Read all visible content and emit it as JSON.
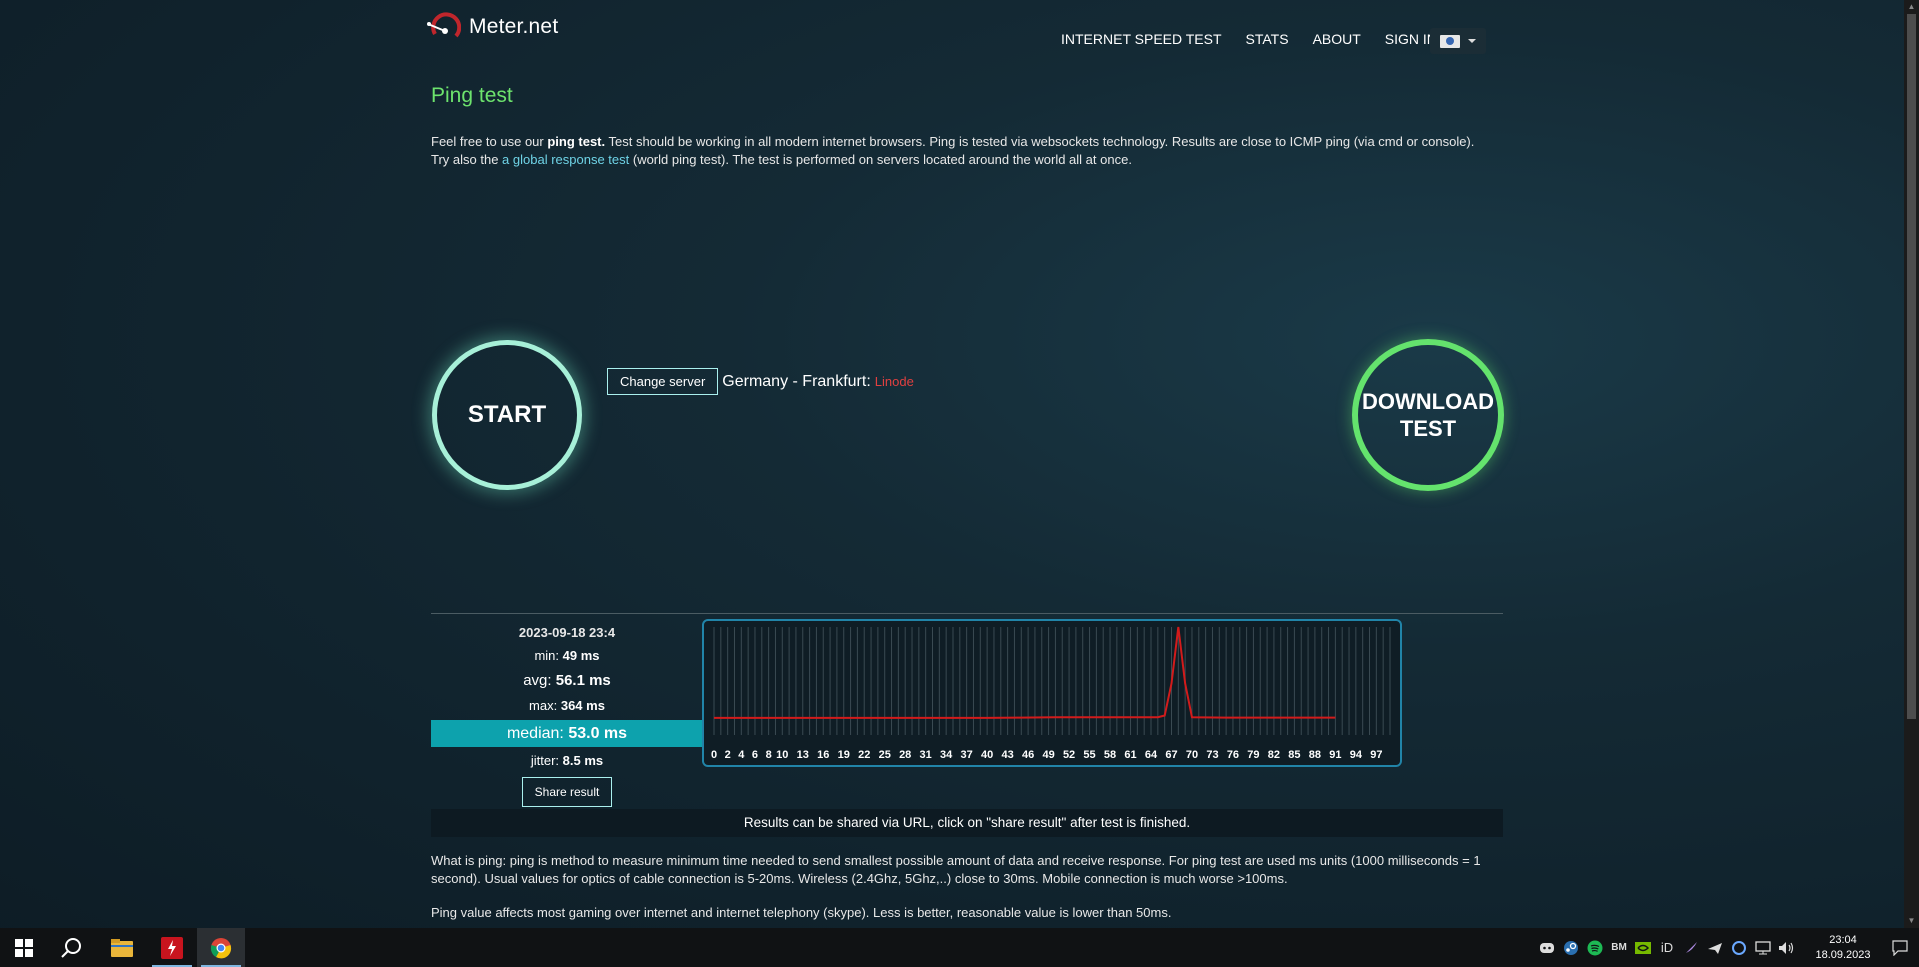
{
  "header": {
    "logo_text": "Meter.net",
    "nav": [
      "INTERNET SPEED TEST",
      "STATS",
      "ABOUT",
      "SIGN IN"
    ]
  },
  "page": {
    "title": "Ping test",
    "intro_pre": "Feel free to use our ",
    "intro_bold": "ping test.",
    "intro_post": " Test should be working in all modern internet browsers. Ping is tested via websockets technology. Results are close to ICMP ping (via cmd or console).",
    "intro2_pre": "Try also the ",
    "intro2_link": "a global response test",
    "intro2_post": " (world ping test). The test is performed on servers located around the world all at once."
  },
  "controls": {
    "start_label": "START",
    "download_label_1": "DOWNLOAD",
    "download_label_2": "TEST",
    "change_server_label": "Change server",
    "server_name": "Germany - Frankfurt:",
    "server_provider": "Linode"
  },
  "results": {
    "timestamp": "2023-09-18 23:4",
    "min_label": "min:",
    "min_value": "49 ms",
    "avg_label": "avg:",
    "avg_value": "56.1 ms",
    "max_label": "max:",
    "max_value": "364 ms",
    "median_label": "median:",
    "median_value": "53.0 ms",
    "jitter_label": "jitter:",
    "jitter_value": "8.5 ms",
    "share_label": "Share result",
    "share_note": "Results can be shared via URL, click on \"share result\" after test is finished."
  },
  "chart_data": {
    "type": "line",
    "x_tick_labels": [
      "0",
      "2",
      "4",
      "6",
      "8",
      "10",
      "13",
      "16",
      "19",
      "22",
      "25",
      "28",
      "31",
      "34",
      "37",
      "40",
      "43",
      "46",
      "49",
      "52",
      "55",
      "58",
      "61",
      "64",
      "67",
      "70",
      "73",
      "76",
      "79",
      "82",
      "85",
      "88",
      "91",
      "94",
      "97"
    ],
    "xlim": [
      0,
      99
    ],
    "ylim": [
      0,
      364
    ],
    "series": [
      {
        "color": "#d21b1b",
        "x": [
          0,
          10,
          20,
          30,
          40,
          45,
          50,
          60,
          65,
          66,
          67,
          68,
          69,
          70,
          75,
          80,
          85,
          90,
          91
        ],
        "y": [
          52,
          52,
          52,
          52,
          52,
          53,
          54,
          54,
          54,
          60,
          170,
          364,
          170,
          54,
          53,
          53,
          53,
          53,
          53
        ]
      }
    ],
    "grid": true
  },
  "info": {
    "p1": "What is ping: ping is method to measure minimum time needed to send smallest possible amount of data and receive response. For ping test are used ms units (1000 milliseconds = 1 second). Usual values for optics of cable connection is 5-20ms. Wireless (2.4Ghz, 5Ghz,..) close to 30ms. Mobile connection is much worse >100ms.",
    "p2": "Ping value affects most gaming over internet and internet telephony (skype). Less is better, reasonable value is lower than 50ms."
  },
  "taskbar": {
    "time": "23:04",
    "date": "18.09.2023",
    "tray_bm": "BM",
    "tray_id": "iD",
    "icons": [
      "windows-start-icon",
      "search-icon",
      "file-explorer-icon",
      "red-app-icon",
      "chrome-icon"
    ]
  }
}
